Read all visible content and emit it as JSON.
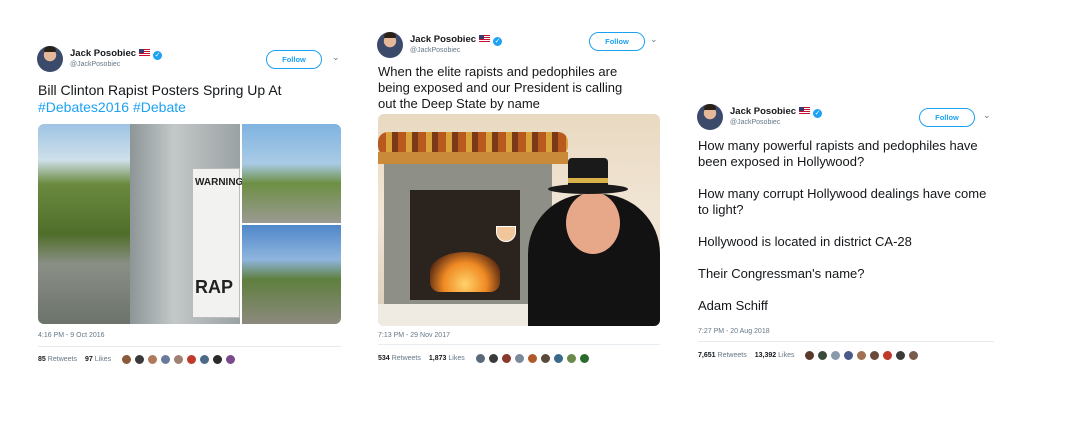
{
  "tweets": [
    {
      "author_name": "Jack Posobiec",
      "author_handle": "@JackPosobiec",
      "follow_label": "Follow",
      "text_plain": "Bill Clinton Rapist Posters Spring Up At",
      "hashtags": [
        "#Debates2016",
        "#Debate"
      ],
      "poster_text": {
        "warning": "WARNING",
        "rap": "RAP"
      },
      "timestamp": "4:16 PM - 9 Oct 2016",
      "retweets_count": "85",
      "retweets_label": "Retweets",
      "likes_count": "97",
      "likes_label": "Likes",
      "liker_colors": [
        "#8a5a3a",
        "#3a3a3a",
        "#b07a5a",
        "#6a7a9a",
        "#a08070",
        "#c0392b",
        "#4a6a8a",
        "#2a2a2a",
        "#7a4a8a"
      ]
    },
    {
      "author_name": "Jack Posobiec",
      "author_handle": "@JackPosobiec",
      "follow_label": "Follow",
      "text_lines": [
        "When the elite rapists and pedophiles are",
        "being exposed and our President is calling",
        "out the Deep State by name"
      ],
      "timestamp": "7:13 PM - 29 Nov 2017",
      "retweets_count": "534",
      "retweets_label": "Retweets",
      "likes_count": "1,873",
      "likes_label": "Likes",
      "liker_colors": [
        "#5a6a7a",
        "#3a3a3a",
        "#8a3a2a",
        "#7a8a9a",
        "#b05a2a",
        "#5a4a3a",
        "#3a6a8a",
        "#6a8a4a",
        "#2a6a2a"
      ]
    },
    {
      "author_name": "Jack Posobiec",
      "author_handle": "@JackPosobiec",
      "follow_label": "Follow",
      "paragraphs": [
        "How many powerful rapists and pedophiles have been exposed in Hollywood?",
        "How many corrupt Hollywood dealings have come to light?",
        "Hollywood is located in district CA-28",
        "Their Congressman's name?",
        "Adam Schiff"
      ],
      "timestamp": "7:27 PM - 20 Aug 2018",
      "retweets_count": "7,651",
      "retweets_label": "Retweets",
      "likes_count": "13,392",
      "likes_label": "Likes",
      "liker_colors": [
        "#5a3a2a",
        "#3a4a3a",
        "#8a9aaa",
        "#4a5a8a",
        "#a07050",
        "#6a4a3a",
        "#c0392b",
        "#3a3a3a",
        "#7a5a4a"
      ]
    }
  ],
  "colors": {
    "accent": "#1da1f2",
    "muted": "#657786",
    "text": "#14171a"
  },
  "icons": [
    "verified-badge-icon",
    "us-flag-icon",
    "chevron-down-icon"
  ]
}
